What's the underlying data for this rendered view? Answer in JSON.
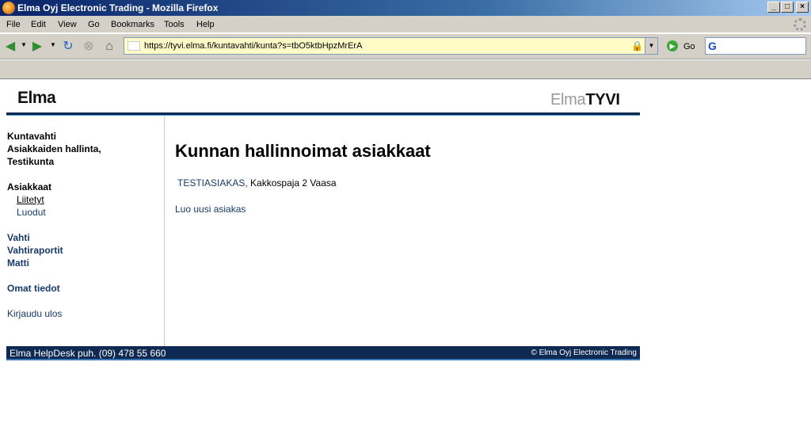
{
  "window": {
    "title": "Elma Oyj Electronic Trading - Mozilla Firefox",
    "minimize_label": "_",
    "maximize_label": "□",
    "close_label": "×"
  },
  "menu": {
    "items": [
      "File",
      "Edit",
      "View",
      "Go",
      "Bookmarks",
      "Tools",
      "Help"
    ]
  },
  "nav": {
    "url": "https://tyvi.elma.fi/kuntavahti/kunta?s=tbO5ktbHpzMrErA",
    "go_label": "Go",
    "search_value": ""
  },
  "header": {
    "logo_left": "Elma",
    "logo_right_prefix": "Elma",
    "logo_right_bold": "TYVI"
  },
  "sidebar": {
    "heading_lines": [
      "Kuntavahti",
      "Asiakkaiden hallinta,",
      "Testikunta"
    ],
    "section_title": "Asiakkaat",
    "sub_items": [
      "Liitetyt",
      "Luodut"
    ],
    "links": [
      "Vahti",
      "Vahtiraportit",
      "Matti"
    ],
    "own_info": "Omat tiedot",
    "logout": "Kirjaudu ulos"
  },
  "main": {
    "title": "Kunnan hallinnoimat asiakkaat",
    "customer_name": "TESTIASIAKAS,",
    "customer_address": " Kakkospaja 2 Vaasa",
    "create_link": "Luo uusi asiakas"
  },
  "footer": {
    "left": "Elma HelpDesk puh. (09) 478 55 660",
    "right": "© Elma Oyj Electronic Trading"
  },
  "colors": {
    "accent": "#0f2a52",
    "link": "#173a6a"
  }
}
